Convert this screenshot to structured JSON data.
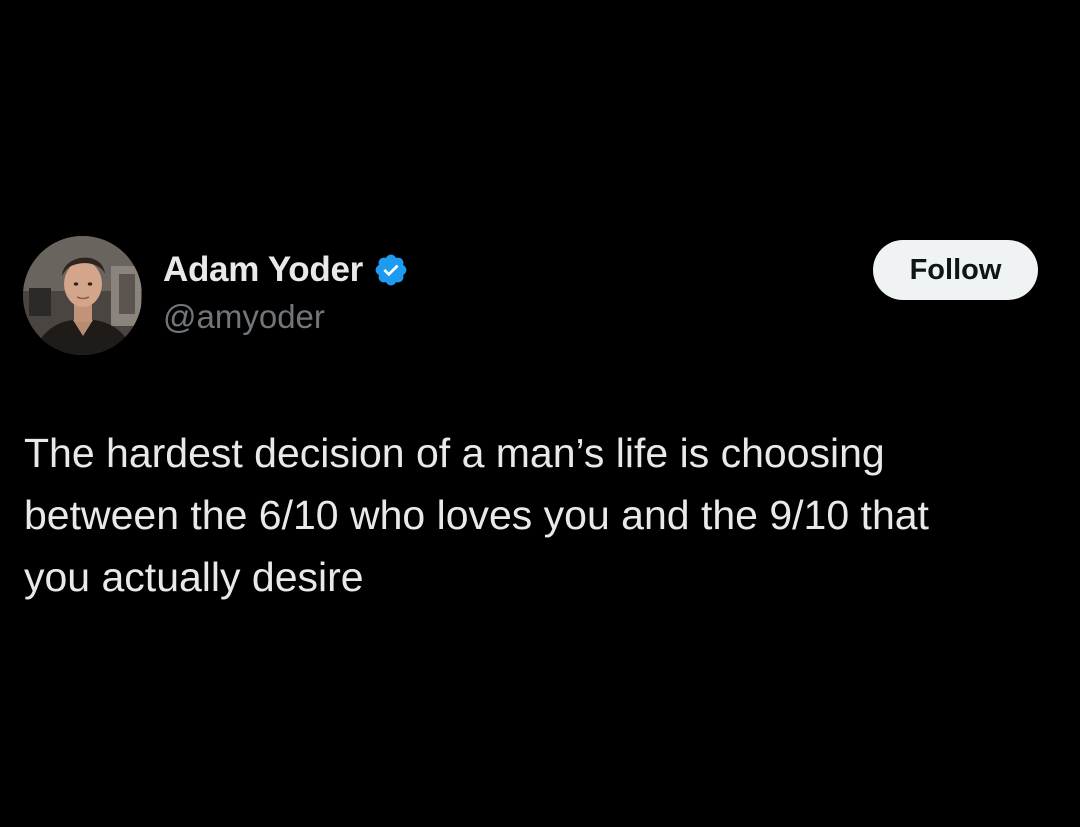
{
  "author": {
    "display_name": "Adam Yoder",
    "handle": "@amyoder",
    "verified": true,
    "verified_icon": "verified-badge-icon",
    "avatar_icon": "profile-photo"
  },
  "actions": {
    "follow_label": "Follow"
  },
  "tweet": {
    "text": "The hardest decision of a man’s life is choosing\nbetween the 6/10 who loves you and the 9/10 that\nyou actually desire"
  },
  "colors": {
    "background": "#000000",
    "primary_text": "#e7e9ea",
    "secondary_text": "#71767b",
    "verified_blue": "#1d9bf0",
    "follow_button_bg": "#eff3f4",
    "follow_button_text": "#0f1419"
  }
}
